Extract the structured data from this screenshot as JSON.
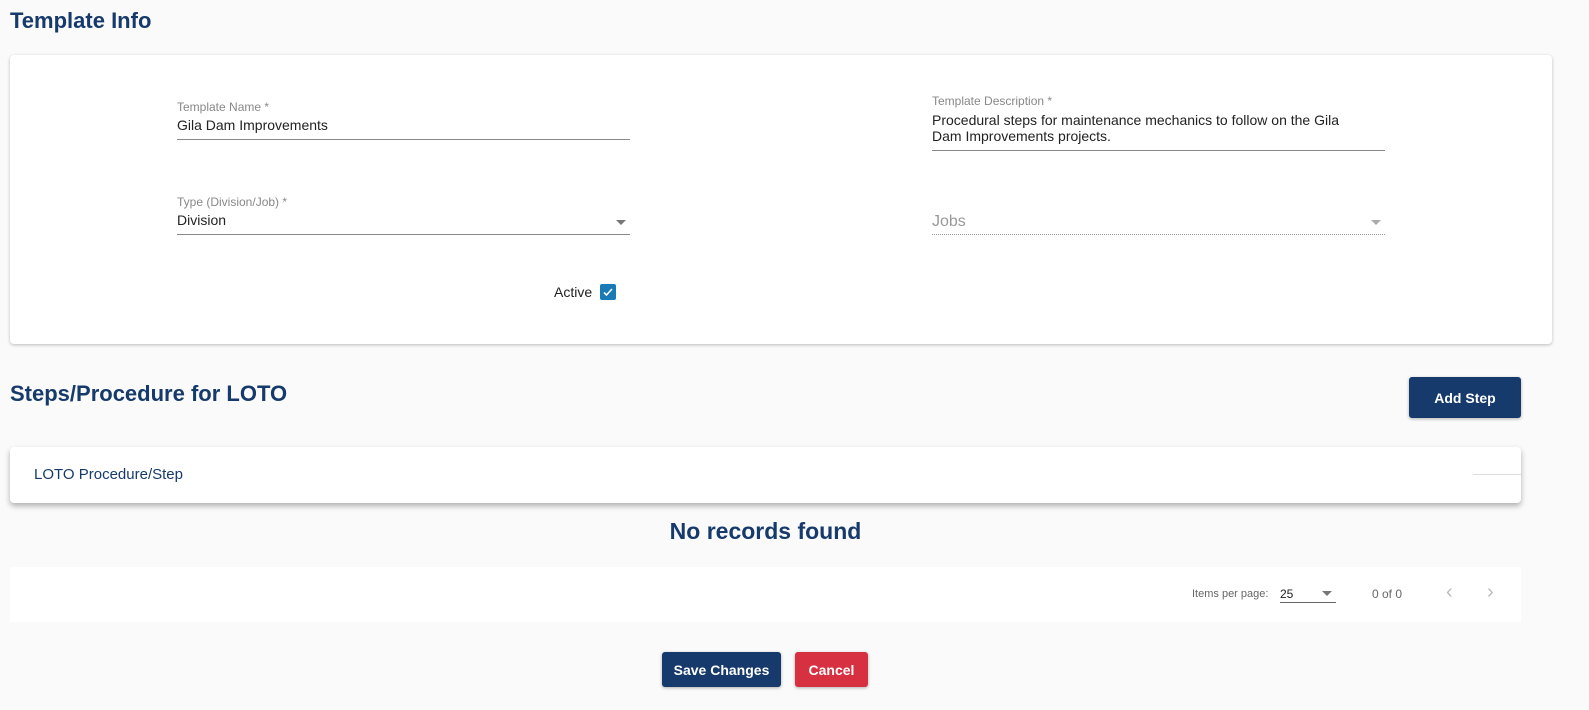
{
  "template_info": {
    "title": "Template Info",
    "name": {
      "label": "Template Name *",
      "value": "Gila Dam Improvements"
    },
    "description": {
      "label": "Template Description *",
      "value": "Procedural steps for maintenance mechanics to follow on the Gila Dam Improvements projects."
    },
    "type": {
      "label": "Type (Division/Job) *",
      "value": "Division"
    },
    "jobs": {
      "placeholder": "Jobs"
    },
    "active": {
      "label": "Active",
      "checked": true
    }
  },
  "steps": {
    "title": "Steps/Procedure for LOTO",
    "add_label": "Add Step",
    "column": "LOTO Procedure/Step",
    "empty": "No records found"
  },
  "paginator": {
    "items_label": "Items per page:",
    "page_size": "25",
    "range": "0 of 0"
  },
  "actions": {
    "save": "Save Changes",
    "cancel": "Cancel"
  },
  "colors": {
    "primary": "#163a6b",
    "danger": "#d73040",
    "checkbox": "#1a7ab8"
  }
}
